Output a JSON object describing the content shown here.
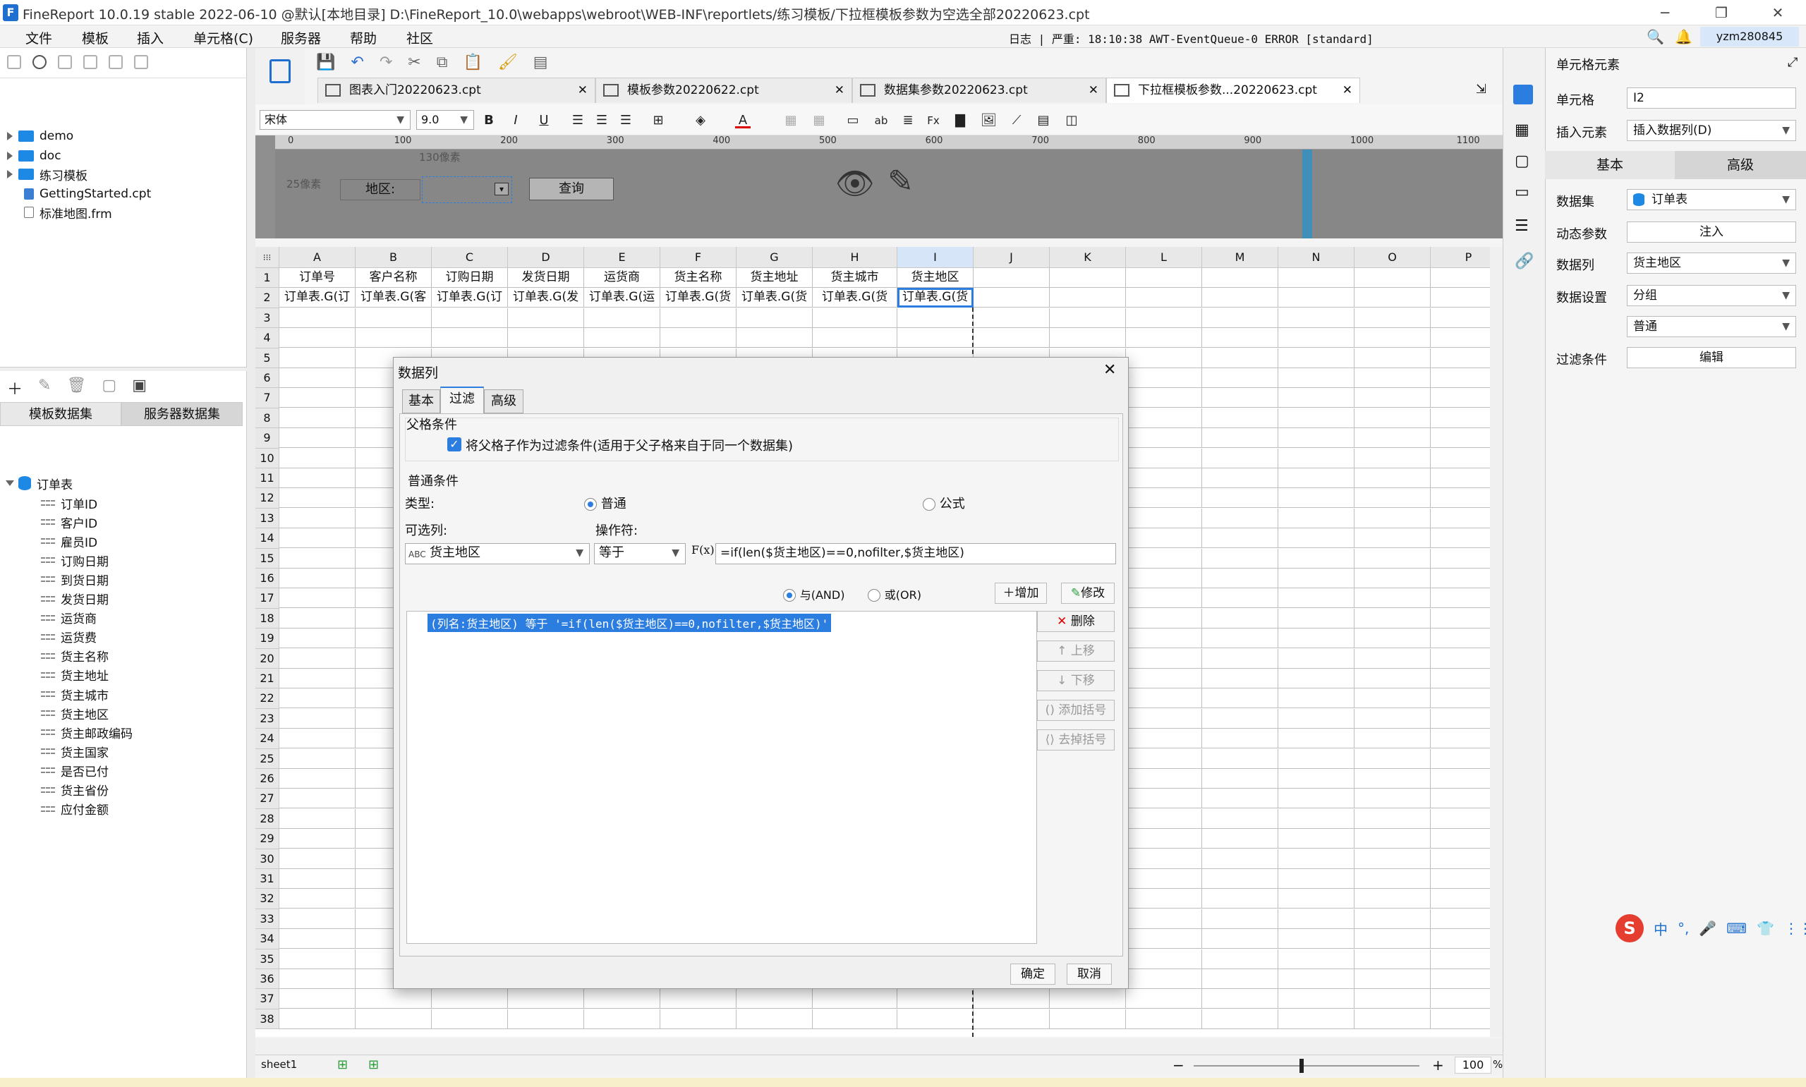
{
  "titlebar": {
    "title": "FineReport 10.0.19 stable 2022-06-10 @默认[本地目录]    D:\\FineReport_10.0\\webapps\\webroot\\WEB-INF\\reportlets/练习模板/下拉框模板参数为空选全部20220623.cpt",
    "minimize": "─",
    "maximize": "❐",
    "close": "✕"
  },
  "menu": [
    "文件",
    "模板",
    "插入",
    "单元格(C)",
    "服务器",
    "帮助",
    "社区"
  ],
  "log_status": "日志  |  严重: 18:10:38 AWT-EventQueue-0 ERROR [standard]",
  "user": "yzm280845",
  "left_tree": [
    {
      "label": "demo",
      "type": "folder"
    },
    {
      "label": "doc",
      "type": "folder"
    },
    {
      "label": "练习模板",
      "type": "folder"
    },
    {
      "label": "GettingStarted.cpt",
      "type": "file"
    },
    {
      "label": "标准地图.frm",
      "type": "file"
    }
  ],
  "dataset_tabs": {
    "template": "模板数据集",
    "server": "服务器数据集"
  },
  "dataset": {
    "name": "订单表",
    "fields": [
      "订单ID",
      "客户ID",
      "雇员ID",
      "订购日期",
      "到货日期",
      "发货日期",
      "运货商",
      "运货费",
      "货主名称",
      "货主地址",
      "货主城市",
      "货主地区",
      "货主邮政编码",
      "货主国家",
      "是否已付",
      "货主省份",
      "应付金额"
    ]
  },
  "doc_tabs": [
    {
      "label": "图表入门20220623.cpt",
      "active": false
    },
    {
      "label": "模板参数20220622.cpt",
      "active": false
    },
    {
      "label": "数据集参数20220623.cpt",
      "active": false
    },
    {
      "label": "下拉框模板参数...20220623.cpt",
      "active": true
    }
  ],
  "format_bar": {
    "font": "宋体",
    "size": "9.0"
  },
  "ruler_ticks": [
    "0",
    "100",
    "200",
    "300",
    "400",
    "500",
    "600",
    "700",
    "800",
    "900",
    "1000",
    "1100"
  ],
  "param_pane": {
    "width_hint": "130像素",
    "height_hint": "25像素",
    "area_label": "地区:",
    "query_button": "查询"
  },
  "columns": [
    "A",
    "B",
    "C",
    "D",
    "E",
    "F",
    "G",
    "H",
    "I",
    "J",
    "K",
    "L",
    "M",
    "N",
    "O",
    "P"
  ],
  "rows": [
    "1",
    "2",
    "3",
    "4",
    "5",
    "6",
    "7",
    "8",
    "9",
    "10",
    "11",
    "12",
    "13",
    "14",
    "15",
    "16",
    "17",
    "18",
    "19",
    "20",
    "21",
    "22",
    "23",
    "24",
    "25",
    "26",
    "27",
    "28",
    "29",
    "30",
    "31",
    "32",
    "33",
    "34",
    "35",
    "36",
    "37",
    "38"
  ],
  "header_row": [
    "订单号",
    "客户名称",
    "订购日期",
    "发货日期",
    "运货商",
    "货主名称",
    "货主地址",
    "货主城市",
    "货主地区"
  ],
  "data_row": [
    "订单表.G(订",
    "订单表.G(客",
    "订单表.G(订",
    "订单表.G(发",
    "订单表.G(运",
    "订单表.G(货",
    "订单表.G(货",
    "订单表.G(货",
    "订单表.G(货"
  ],
  "sheet_tab": "sheet1",
  "zoom": "100",
  "zoom_suffix": "%",
  "right_panel": {
    "title": "单元格元素",
    "cell_label": "单元格",
    "cell_value": "I2",
    "insert_label": "插入元素",
    "insert_value": "插入数据列(D)",
    "tab_basic": "基本",
    "tab_advanced": "高级",
    "dataset_label": "数据集",
    "dataset_value": "订单表",
    "dynamic_label": "动态参数",
    "dynamic_button": "注入",
    "column_label": "数据列",
    "column_value": "货主地区",
    "setting_label": "数据设置",
    "setting_value": "分组",
    "setting_value2": "普通",
    "filter_label": "过滤条件",
    "filter_button": "编辑"
  },
  "dialog": {
    "title": "数据列",
    "close": "✕",
    "tabs": [
      "基本",
      "过滤",
      "高级"
    ],
    "parent_section": "父格条件",
    "parent_checkbox": "将父格子作为过滤条件(适用于父子格来自于同一个数据集)",
    "normal_section": "普通条件",
    "type_label": "类型:",
    "type_normal": "普通",
    "type_formula": "公式",
    "col_label": "可选列:",
    "op_label": "操作符:",
    "col_value": "货主地区",
    "op_value": "等于",
    "formula_value": "=if(len($货主地区)==0,nofilter,$货主地区)",
    "and_label": "与(AND)",
    "or_label": "或(OR)",
    "add_button": "增加",
    "modify_button": "修改",
    "condition": "(列名:货主地区) 等于 '=if(len($货主地区)==0,nofilter,$货主地区)'",
    "side_buttons": [
      "删除",
      "上移",
      "下移",
      "添加括号",
      "去掉括号"
    ],
    "ok": "确定",
    "cancel": "取消"
  },
  "ime": [
    "中",
    "°,",
    "🎤",
    "⌨",
    "👕",
    "⋮⋮"
  ]
}
